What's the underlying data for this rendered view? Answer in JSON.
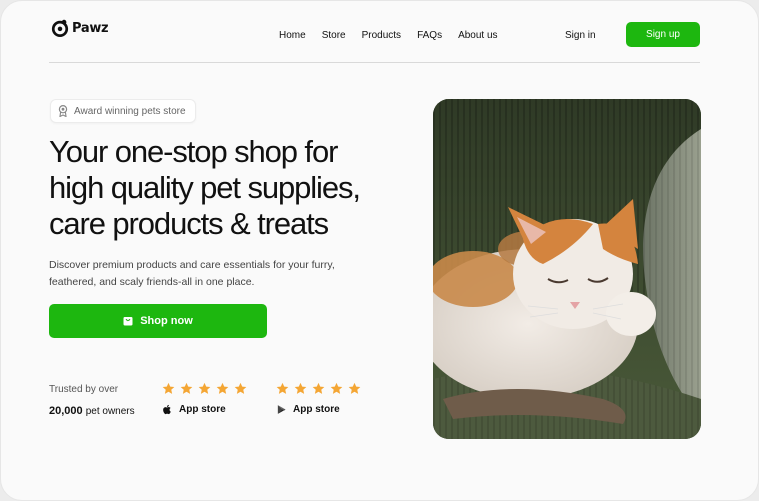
{
  "brand": {
    "name": "Pawz",
    "logo_icon": "paw-logo-icon"
  },
  "nav": {
    "links": [
      "Home",
      "Store",
      "Products",
      "FAQs",
      "About us"
    ],
    "sign_in": "Sign in",
    "sign_up": "Sign up"
  },
  "hero": {
    "badge": "Award winning pets store",
    "headline": [
      "Your one-stop shop for",
      "high quality pet supplies,",
      "care products & treats"
    ],
    "description": [
      "Discover premium products and care essentials for your furry,",
      "feathered, and scaly friends-all in one place."
    ],
    "cta": "Shop now",
    "trusted_label": "Trusted by over",
    "owners_count": "20,000",
    "owners_label": "pet owners",
    "ratings": [
      {
        "store": "App store",
        "icon": "apple-icon",
        "stars": 5
      },
      {
        "store": "App store",
        "icon": "play-store-icon",
        "stars": 5
      }
    ]
  },
  "colors": {
    "accent": "#1db70f",
    "star": "#f4a634"
  }
}
